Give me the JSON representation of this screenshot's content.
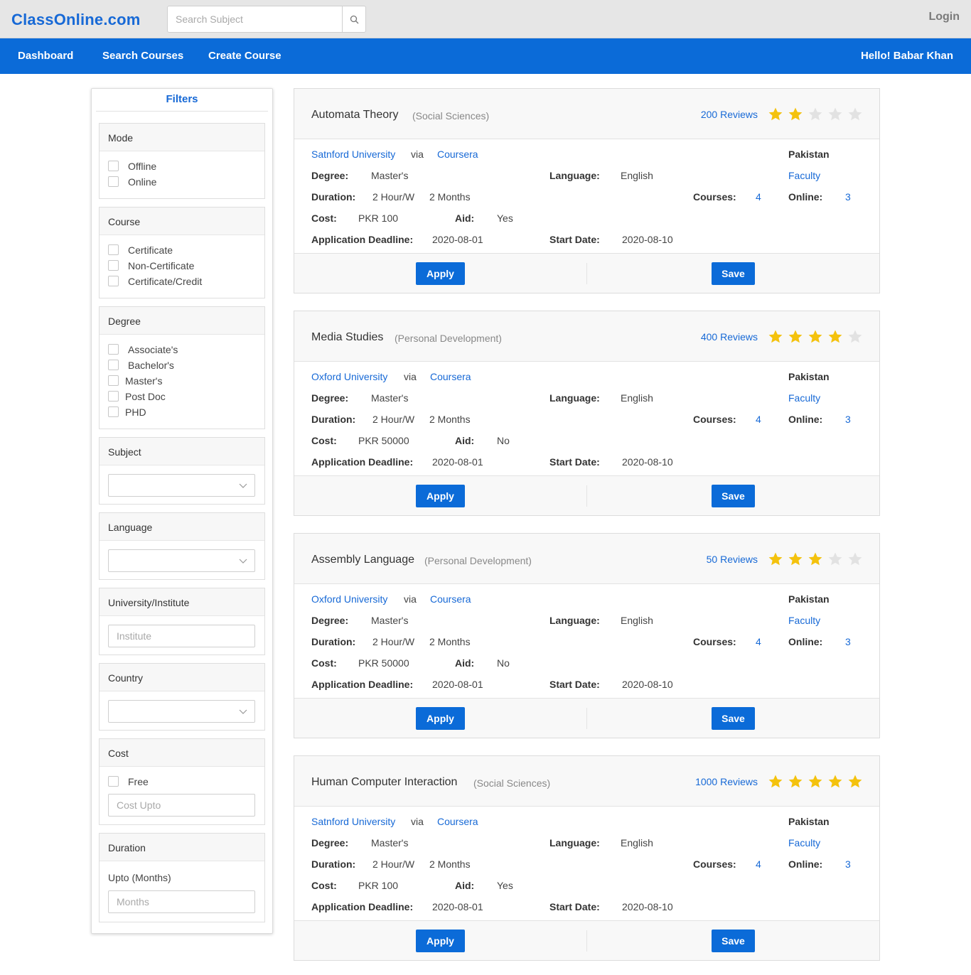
{
  "brand": "ClassOnline.com",
  "search": {
    "placeholder": "Search Subject",
    "value": ""
  },
  "login_label": "Login",
  "nav": {
    "dashboard": "Dashboard",
    "search_courses": "Search Courses",
    "create_course": "Create Course",
    "greeting": "Hello! Babar Khan"
  },
  "colors": {
    "brand": "#1769d6",
    "nav_bg": "#0b6bd8",
    "star_on": "#f4c20d",
    "star_off": "#e2e2e2"
  },
  "filters": {
    "title": "Filters",
    "mode": {
      "title": "Mode",
      "options": [
        "Offline",
        "Online"
      ]
    },
    "course": {
      "title": "Course",
      "options": [
        "Certificate",
        "Non-Certificate",
        "Certificate/Credit"
      ]
    },
    "degree": {
      "title": "Degree",
      "options": [
        "Associate's",
        "Bachelor's",
        "Master's",
        "Post Doc",
        "PHD"
      ]
    },
    "subject": {
      "title": "Subject",
      "selected": ""
    },
    "language": {
      "title": "Language",
      "selected": ""
    },
    "university": {
      "title": "University/Institute",
      "placeholder": "Institute"
    },
    "country": {
      "title": "Country",
      "selected": ""
    },
    "cost": {
      "title": "Cost",
      "free_label": "Free",
      "placeholder": "Cost Upto"
    },
    "duration": {
      "title": "Duration",
      "label": "Upto (Months)",
      "placeholder": "Months"
    }
  },
  "labels": {
    "via": "via",
    "degree": "Degree:",
    "language": "Language:",
    "duration": "Duration:",
    "courses": "Courses:",
    "online": "Online:",
    "cost": "Cost:",
    "aid": "Aid:",
    "deadline": "Application Deadline:",
    "start": "Start Date:",
    "faculty": "Faculty",
    "apply": "Apply",
    "save": "Save"
  },
  "courses": [
    {
      "title": "Automata Theory",
      "category": "(Social Sciences)",
      "reviews": "200 Reviews",
      "rating": 2,
      "university": "Satnford University",
      "platform": "Coursera",
      "country": "Pakistan",
      "degree": "Master's",
      "language": "English",
      "hours": "2 Hour/W",
      "months": "2 Months",
      "courses_count": "4",
      "online_count": "3",
      "cost": "PKR 100",
      "aid": "Yes",
      "deadline": "2020-08-01",
      "start_date": "2020-08-10"
    },
    {
      "title": "Media Studies",
      "category": "(Personal Development)",
      "reviews": "400 Reviews",
      "rating": 4,
      "university": "Oxford University",
      "platform": "Coursera",
      "country": "Pakistan",
      "degree": "Master's",
      "language": "English",
      "hours": "2 Hour/W",
      "months": "2 Months",
      "courses_count": "4",
      "online_count": "3",
      "cost": "PKR 50000",
      "aid": "No",
      "deadline": "2020-08-01",
      "start_date": "2020-08-10"
    },
    {
      "title": "Assembly Language",
      "category": "(Personal Development)",
      "reviews": "50 Reviews",
      "rating": 3,
      "university": "Oxford University",
      "platform": "Coursera",
      "country": "Pakistan",
      "degree": "Master's",
      "language": "English",
      "hours": "2 Hour/W",
      "months": "2 Months",
      "courses_count": "4",
      "online_count": "3",
      "cost": "PKR 50000",
      "aid": "No",
      "deadline": "2020-08-01",
      "start_date": "2020-08-10"
    },
    {
      "title": "Human Computer Interaction",
      "category": "(Social Sciences)",
      "reviews": "1000 Reviews",
      "rating": 5,
      "university": "Satnford University",
      "platform": "Coursera",
      "country": "Pakistan",
      "degree": "Master's",
      "language": "English",
      "hours": "2 Hour/W",
      "months": "2 Months",
      "courses_count": "4",
      "online_count": "3",
      "cost": "PKR 100",
      "aid": "Yes",
      "deadline": "2020-08-01",
      "start_date": "2020-08-10"
    }
  ]
}
